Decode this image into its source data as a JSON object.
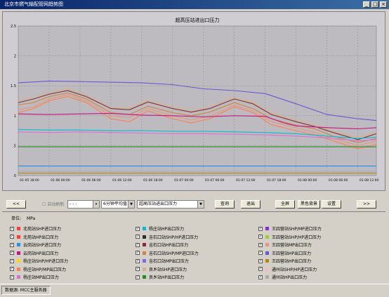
{
  "window": {
    "title": "北京市燃气输配管网趋势图"
  },
  "chart_data": {
    "type": "line",
    "title": "超高压站进出口压力",
    "ylim": [
      0,
      2.5
    ],
    "yticks": [
      "0",
      ".5",
      "1",
      "1.5",
      "2",
      "2.5"
    ],
    "xticks": [
      "01-05 18:00",
      "01-06 00:00",
      "01-06 06:00",
      "01-06 12:00",
      "01-06 18:00",
      "01-07 00:00",
      "01-07 06:00",
      "01-07 12:00",
      "01-07 18:00",
      "01-08 00:00",
      "01-08 06:00",
      "01-08 12:00"
    ],
    "xlim": [
      0,
      11.6
    ],
    "grid": true,
    "series": [
      {
        "color": "#6a5acd",
        "x": [
          0,
          1,
          2,
          3,
          4,
          5,
          6,
          7,
          8,
          9,
          10,
          11,
          11.6
        ],
        "values": [
          1.55,
          1.58,
          1.57,
          1.56,
          1.55,
          1.52,
          1.45,
          1.42,
          1.37,
          1.2,
          1.02,
          0.95,
          0.92
        ]
      },
      {
        "color": "#8b2b2b",
        "x": [
          0,
          0.5,
          1,
          1.6,
          2.2,
          3,
          3.6,
          4.2,
          5,
          5.6,
          6.2,
          7,
          7.6,
          8.2,
          9,
          9.6,
          10.2,
          11,
          11.6
        ],
        "values": [
          1.22,
          1.28,
          1.36,
          1.42,
          1.32,
          1.12,
          1.1,
          1.23,
          1.12,
          1.06,
          1.12,
          1.28,
          1.2,
          1.02,
          0.9,
          0.82,
          0.72,
          0.6,
          0.7
        ]
      },
      {
        "color": "#d2b48c",
        "x": [
          0,
          0.5,
          1,
          1.6,
          2.2,
          3,
          3.6,
          4.2,
          5,
          5.6,
          6.2,
          7,
          7.6,
          8.2,
          9,
          9.6,
          10.2,
          11,
          11.6
        ],
        "values": [
          1.25,
          1.32,
          1.4,
          1.45,
          1.35,
          1.15,
          1.13,
          1.26,
          1.15,
          1.09,
          1.15,
          1.31,
          1.23,
          1.05,
          0.93,
          0.85,
          0.75,
          0.63,
          0.73
        ]
      },
      {
        "color": "#cd853f",
        "x": [
          0,
          0.5,
          1,
          1.6,
          2.2,
          3,
          3.6,
          4.2,
          5,
          5.6,
          6.2,
          7,
          7.6,
          8.2,
          9,
          9.6,
          10.2,
          11,
          11.6
        ],
        "values": [
          1.18,
          1.22,
          1.32,
          1.38,
          1.28,
          1.05,
          1.02,
          1.16,
          1.05,
          1.0,
          1.06,
          1.22,
          1.12,
          0.95,
          0.84,
          0.78,
          0.66,
          0.55,
          0.62
        ]
      },
      {
        "color": "#ff7f50",
        "x": [
          0,
          0.5,
          1,
          1.6,
          2.2,
          3,
          3.6,
          4.2,
          5,
          5.6,
          6.2,
          7,
          7.6,
          8.2,
          9,
          9.6,
          10.2,
          11,
          11.6
        ],
        "values": [
          1.05,
          1.12,
          1.25,
          1.32,
          1.22,
          0.95,
          0.9,
          1.08,
          0.95,
          0.88,
          0.95,
          1.15,
          1.05,
          0.85,
          0.75,
          0.68,
          0.58,
          0.45,
          0.52
        ]
      },
      {
        "color": "#e9967a",
        "x": [
          0,
          0.5,
          1,
          1.6,
          2.2,
          3,
          3.6,
          4.2,
          5,
          5.6,
          6.2,
          7,
          7.6,
          8.2,
          9,
          9.6,
          10.2,
          11,
          11.6
        ],
        "values": [
          1.1,
          1.15,
          1.28,
          1.35,
          1.25,
          1.0,
          0.97,
          1.12,
          1.0,
          0.93,
          0.99,
          1.18,
          1.08,
          0.9,
          0.8,
          0.72,
          0.62,
          0.5,
          0.58
        ]
      },
      {
        "color": "#c71585",
        "x": [
          0,
          1,
          2,
          3,
          4,
          5,
          6,
          7,
          8,
          8.6,
          9,
          10,
          11,
          11.6
        ],
        "values": [
          1.03,
          1.02,
          1.03,
          1.04,
          1.01,
          1.0,
          0.98,
          1.0,
          0.99,
          0.88,
          0.83,
          0.8,
          0.78,
          0.8
        ]
      },
      {
        "color": "#da70d6",
        "x": [
          0,
          1,
          2,
          3,
          4,
          5,
          6,
          7,
          8,
          9,
          10,
          11,
          11.6
        ],
        "values": [
          0.73,
          0.72,
          0.73,
          0.72,
          0.71,
          0.7,
          0.7,
          0.69,
          0.68,
          0.66,
          0.63,
          0.58,
          0.6
        ]
      },
      {
        "color": "#00bcd4",
        "x": [
          0,
          1,
          2,
          3,
          4,
          5,
          6,
          7,
          8,
          9,
          10,
          11,
          11.6
        ],
        "values": [
          0.77,
          0.76,
          0.76,
          0.75,
          0.75,
          0.74,
          0.74,
          0.73,
          0.72,
          0.7,
          0.66,
          0.62,
          0.64
        ]
      },
      {
        "color": "#228b22",
        "x": [
          0,
          1,
          2,
          3,
          4,
          5,
          6,
          7,
          8,
          9,
          10,
          11,
          11.6
        ],
        "values": [
          0.48,
          0.48,
          0.48,
          0.48,
          0.48,
          0.48,
          0.48,
          0.48,
          0.48,
          0.48,
          0.48,
          0.48,
          0.48
        ]
      },
      {
        "color": "#1e90ff",
        "x": [
          0,
          1,
          2,
          3,
          4,
          5,
          6,
          7,
          8,
          9,
          10,
          11,
          11.6
        ],
        "values": [
          0.16,
          0.16,
          0.16,
          0.16,
          0.16,
          0.16,
          0.16,
          0.16,
          0.16,
          0.16,
          0.16,
          0.16,
          0.16
        ]
      },
      {
        "color": "#a9a9a9",
        "x": [
          0,
          1,
          2,
          3,
          4,
          5,
          6,
          7,
          8,
          9,
          10,
          11,
          11.6
        ],
        "values": [
          0.07,
          0.07,
          0.07,
          0.07,
          0.07,
          0.07,
          0.07,
          0.07,
          0.07,
          0.07,
          0.07,
          0.07,
          0.07
        ]
      },
      {
        "color": "#b8860b",
        "x": [
          0,
          1,
          2,
          3,
          4,
          5,
          6,
          7,
          8,
          9,
          10,
          11,
          11.6
        ],
        "values": [
          0.04,
          0.04,
          0.04,
          0.04,
          0.04,
          0.04,
          0.04,
          0.04,
          0.04,
          0.04,
          0.04,
          0.04,
          0.04
        ]
      }
    ]
  },
  "controls": {
    "prev": "<<",
    "next": ">>",
    "auto_refresh": "自动刷新",
    "time_value": "- - :",
    "interval": "6分钟平均值",
    "station": "超高压站进出口压力",
    "query": "查询",
    "exit": "退出",
    "fullscreen": "全屏",
    "black_bg": "黑色背景",
    "settings": "设置"
  },
  "legend": {
    "unit_label": "单位:",
    "unit_value": "MPa",
    "col1": [
      {
        "label": "北苑站SHP进口压力",
        "color": "#ff3b3b"
      },
      {
        "label": "北苑站HP出口压力",
        "color": "#ff3b3b"
      },
      {
        "label": "云岗站SHP进口压力",
        "color": "#1e90ff"
      },
      {
        "label": "云岗站HP出口压力",
        "color": "#c71585"
      },
      {
        "label": "杨庄站SHP/HP进口压力",
        "color": "#ffd700"
      },
      {
        "label": "杨庄站HP/MP出口压力",
        "color": "#ff7f50"
      },
      {
        "label": "杨庄站MP出口压力",
        "color": "#da70d6"
      }
    ],
    "col2": [
      {
        "label": "杨庄站HP出口压力",
        "color": "#00bcd4"
      },
      {
        "label": "吉石口站SHP/HP进口压力",
        "color": "#2f2f2f"
      },
      {
        "label": "吉石口站HP出口压力",
        "color": "#8b2b2b"
      },
      {
        "label": "吉石口站SHP/MP进口压力",
        "color": "#cd853f"
      },
      {
        "label": "吉石口站MP出口压力",
        "color": "#7b68ee"
      },
      {
        "label": "良乡站SHP进口压力",
        "color": "#d2b48c"
      },
      {
        "label": "良乡站HP出口压力",
        "color": "#228b22"
      }
    ],
    "col3": [
      {
        "label": "王四营站SHP/MP进口压力",
        "color": "#8a2be2"
      },
      {
        "label": "王四营站SHP/HP进口压力",
        "color": "#9acd32"
      },
      {
        "label": "王四营站MP出口压力",
        "color": "#e9967a"
      },
      {
        "label": "王四营站HP出口压力",
        "color": "#6a5acd"
      },
      {
        "label": "王四营站HP出口压力",
        "color": "#b8860b"
      },
      {
        "label": "通州站SHP/HP进口压力",
        "color": "#ffb6c1"
      },
      {
        "label": "通州站HP出口压力",
        "color": "#a9a9a9"
      }
    ]
  },
  "status": {
    "source": "数据源: MCC主服务器"
  }
}
